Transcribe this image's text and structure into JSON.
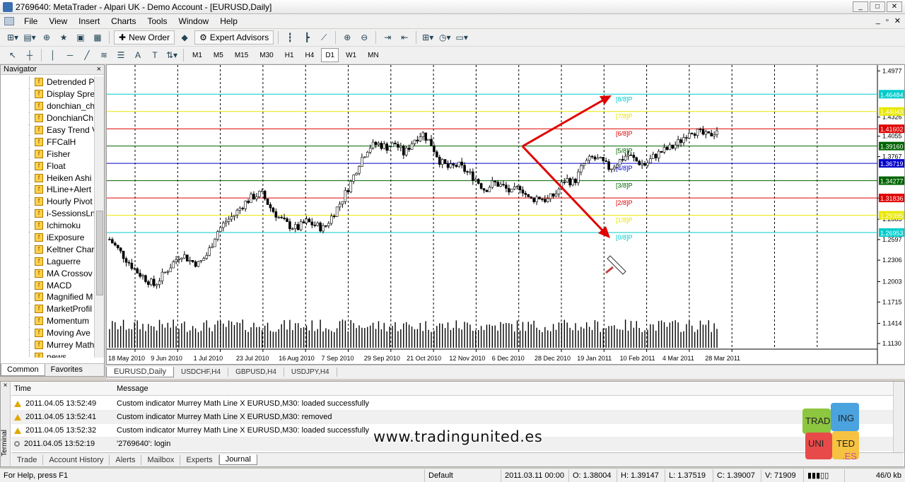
{
  "window": {
    "title": "2769640: MetaTrader - Alpari UK - Demo Account - [EURUSD,Daily]",
    "controls": [
      "_",
      "□",
      "✕"
    ]
  },
  "menu": [
    "File",
    "View",
    "Insert",
    "Charts",
    "Tools",
    "Window",
    "Help"
  ],
  "mdi_controls": [
    "_",
    "▫",
    "✕"
  ],
  "toolbar": {
    "new_order": "New Order",
    "expert_advisors": "Expert Advisors"
  },
  "timeframes": [
    "M1",
    "M5",
    "M15",
    "M30",
    "H1",
    "H4",
    "D1",
    "W1",
    "MN"
  ],
  "active_timeframe": "D1",
  "navigator": {
    "title": "Navigator",
    "close": "×",
    "items": [
      "Detrended P",
      "Display Spre",
      "donchian_ch",
      "DonchianCh",
      "Easy Trend V",
      "FFCalH",
      "Fisher",
      "Float",
      "Heiken Ashi",
      "HLine+Alert",
      "Hourly Pivot",
      "i-SessionsLn",
      "Ichimoku",
      "iExposure",
      "Keltner Char",
      "Laguerre",
      "MA Crossov",
      "MACD",
      "Magnified M",
      "MarketProfil",
      "Momentum",
      "Moving Ave",
      "Murrey Math",
      "news"
    ],
    "tabs": [
      "Common",
      "Favorites"
    ]
  },
  "chart_tabs": [
    "EURUSD,Daily",
    "USDCHF,H4",
    "GBPUSD,H4",
    "USDJPY,H4"
  ],
  "chart_data": {
    "type": "candlestick",
    "symbol": "EURUSD",
    "timeframe": "Daily",
    "x_labels": [
      "18 May 2010",
      "9 Jun 2010",
      "1 Jul 2010",
      "23 Jul 2010",
      "16 Aug 2010",
      "7 Sep 2010",
      "29 Sep 2010",
      "21 Oct 2010",
      "12 Nov 2010",
      "6 Dec 2010",
      "28 Dec 2010",
      "19 Jan 2011",
      "10 Feb 2011",
      "4 Mar 2011",
      "28 Mar 2011"
    ],
    "y_ticks": [
      1.4977,
      1.4326,
      1.4055,
      1.3767,
      1.3182,
      1.2883,
      1.2597,
      1.2306,
      1.2003,
      1.1715,
      1.1414,
      1.113
    ],
    "ylim": [
      1.105,
      1.502
    ],
    "grid": true,
    "price_path": [
      1.26,
      1.245,
      1.23,
      1.215,
      1.205,
      1.195,
      1.21,
      1.225,
      1.24,
      1.23,
      1.225,
      1.24,
      1.27,
      1.285,
      1.295,
      1.31,
      1.32,
      1.325,
      1.305,
      1.29,
      1.28,
      1.275,
      1.285,
      1.28,
      1.275,
      1.295,
      1.315,
      1.34,
      1.37,
      1.39,
      1.395,
      1.39,
      1.395,
      1.38,
      1.4,
      1.41,
      1.395,
      1.37,
      1.36,
      1.365,
      1.355,
      1.345,
      1.33,
      1.34,
      1.335,
      1.325,
      1.335,
      1.315,
      1.32,
      1.315,
      1.325,
      1.345,
      1.34,
      1.365,
      1.375,
      1.37,
      1.36,
      1.37,
      1.38,
      1.37,
      1.365,
      1.378,
      1.385,
      1.39,
      1.4,
      1.415,
      1.41,
      1.405,
      1.415
    ],
    "murrey_levels": [
      {
        "label": "[8/8]P",
        "price": 1.46484,
        "color": "#00cccc"
      },
      {
        "label": "[7/8]P",
        "price": 1.44043,
        "color": "#e8e800"
      },
      {
        "label": "[6/8]P",
        "price": 1.41602,
        "color": "#e00000"
      },
      {
        "label": "[5/8]P",
        "price": 1.3916,
        "color": "#006400"
      },
      {
        "label": "[4/8]P",
        "price": 1.36719,
        "color": "#0000cc"
      },
      {
        "label": "[3/8]P",
        "price": 1.34277,
        "color": "#006400"
      },
      {
        "label": "[2/8]P",
        "price": 1.31836,
        "color": "#e00000"
      },
      {
        "label": "[1/8]P",
        "price": 1.29395,
        "color": "#e8e800"
      },
      {
        "label": "[0/8]P",
        "price": 1.26953,
        "color": "#00cccc"
      }
    ],
    "price_tags": [
      "1.46484",
      "1.44043",
      "1.41602",
      "1.39160",
      "1.36719",
      "1.34277",
      "1.31836",
      "1.29395",
      "1.26953"
    ]
  },
  "terminal": {
    "side_label": "Terminal",
    "close": "×",
    "headers": {
      "time": "Time",
      "message": "Message"
    },
    "rows": [
      {
        "time": "2011.04.05 13:52:49",
        "message": "Custom indicator Murrey Math Line X EURUSD,M30: loaded successfully",
        "icon": "warning-icon"
      },
      {
        "time": "2011.04.05 13:52:41",
        "message": "Custom indicator Murrey Math Line X EURUSD,M30: removed",
        "icon": "warning-icon"
      },
      {
        "time": "2011.04.05 13:52:32",
        "message": "Custom indicator Murrey Math Line X EURUSD,M30: loaded successfully",
        "icon": "warning-icon"
      },
      {
        "time": "2011.04.05 13:52:19",
        "message": "'2769640': login",
        "icon": "info-icon"
      }
    ],
    "tabs": [
      "Trade",
      "Account History",
      "Alerts",
      "Mailbox",
      "Experts",
      "Journal"
    ],
    "active_tab": "Journal"
  },
  "statusbar": {
    "help": "For Help, press F1",
    "profile": "Default",
    "datetime": "2011.03.11 00:00",
    "open": "O: 1.38004",
    "high": "H: 1.39147",
    "low": "L: 1.37519",
    "close": "C: 1.39007",
    "volume": "V: 71909",
    "traffic": "46/0 kb"
  },
  "watermark": "www.tradingunited.es",
  "logo_text": [
    "TRAD",
    "ING",
    "UNI",
    "TED",
    ".ES"
  ]
}
